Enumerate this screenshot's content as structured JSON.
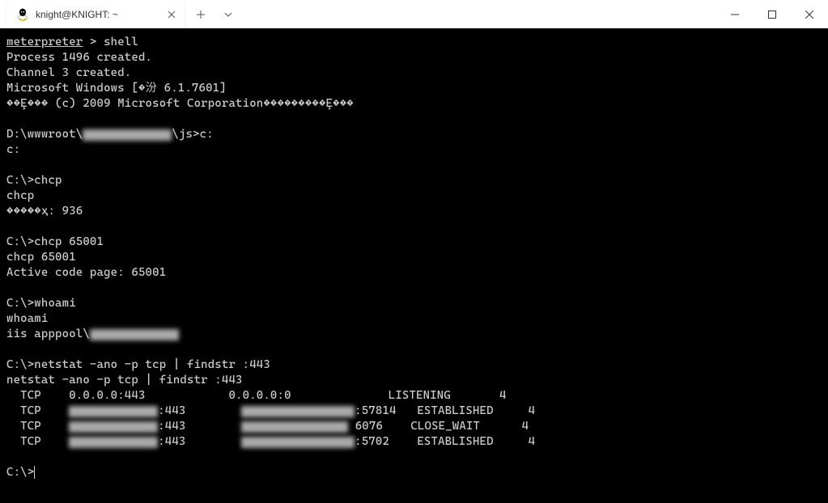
{
  "titlebar": {
    "tab_title": "knight@KNIGHT: ~"
  },
  "terminal": {
    "meterpreter_prompt": "meterpreter",
    "shell_cmd": " > shell",
    "line_process": "Process 1496 created.",
    "line_channel": "Channel 3 created.",
    "line_winver": "Microsoft Windows [�汾 6.1.7601]",
    "line_copyright": "��Ȩ��� (c) 2009 Microsoft Corporation���������Ȩ���",
    "path_prefix": "D:\\wwwroot\\",
    "path_suffix": "\\js>c:",
    "line_c": "c:",
    "prompt_chcp": "C:\\>chcp",
    "echo_chcp": "chcp",
    "line_chcp_out": "�����ҳ: 936",
    "prompt_chcp2": "C:\\>chcp 65001",
    "echo_chcp2": "chcp 65001",
    "line_active": "Active code page: 65001",
    "prompt_whoami": "C:\\>whoami",
    "echo_whoami": "whoami",
    "iis_prefix": "iis apppool\\",
    "prompt_netstat": "C:\\>netstat -ano -p tcp | findstr :443",
    "echo_netstat": "netstat -ano -p tcp | findstr :443",
    "row1": "  TCP    0.0.0.0:443            0.0.0.0:0              LISTENING       4",
    "row2_start": "  TCP    ",
    "row2_mid": ":443        ",
    "row2_end": ":57814   ESTABLISHED     4",
    "row3_start": "  TCP    ",
    "row3_mid": ":443        ",
    "row3_port": "6076    CLOSE_WAIT      4",
    "row4_start": "  TCP    ",
    "row4_mid": ":443        ",
    "row4_end": ":5702    ESTABLISHED     4",
    "prompt_final": "C:\\>"
  }
}
